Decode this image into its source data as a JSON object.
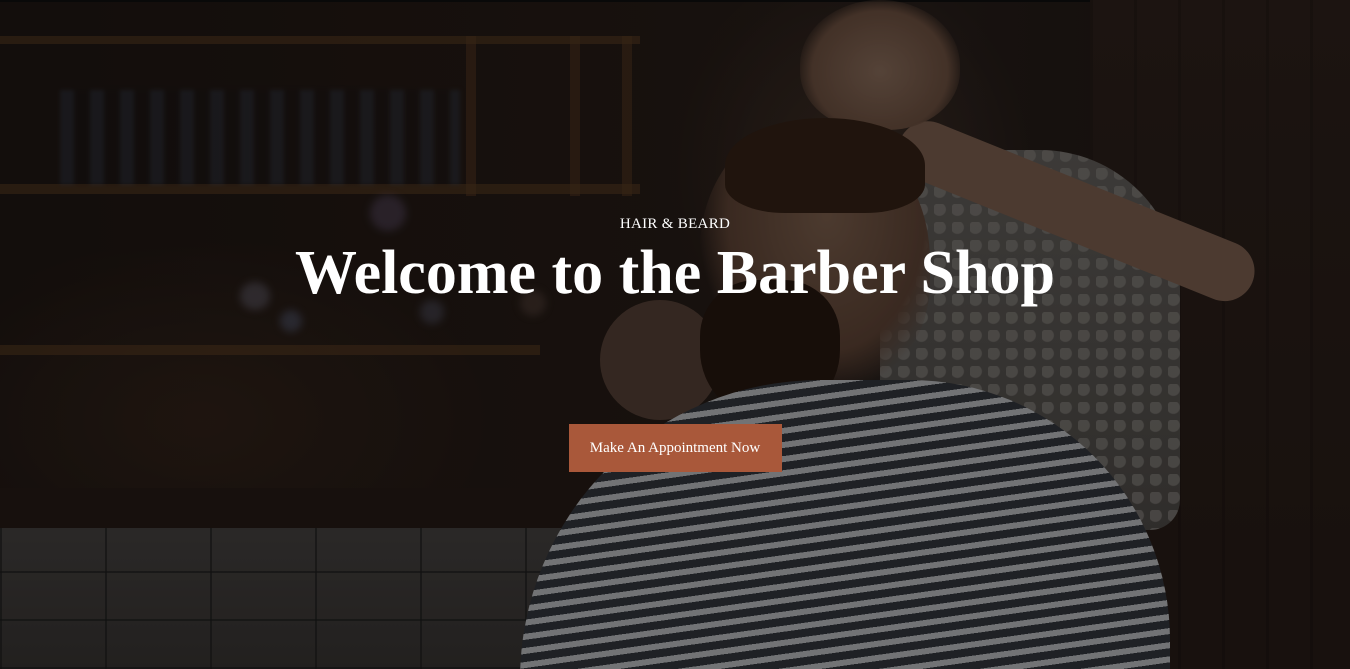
{
  "hero": {
    "kicker": "HAIR & BEARD",
    "title": "Welcome to the Barber Shop",
    "cta_label": "Make An Appointment Now"
  },
  "colors": {
    "cta_background": "#a9583a",
    "text": "#ffffff",
    "overlay": "rgba(0,0,0,0.45)"
  }
}
